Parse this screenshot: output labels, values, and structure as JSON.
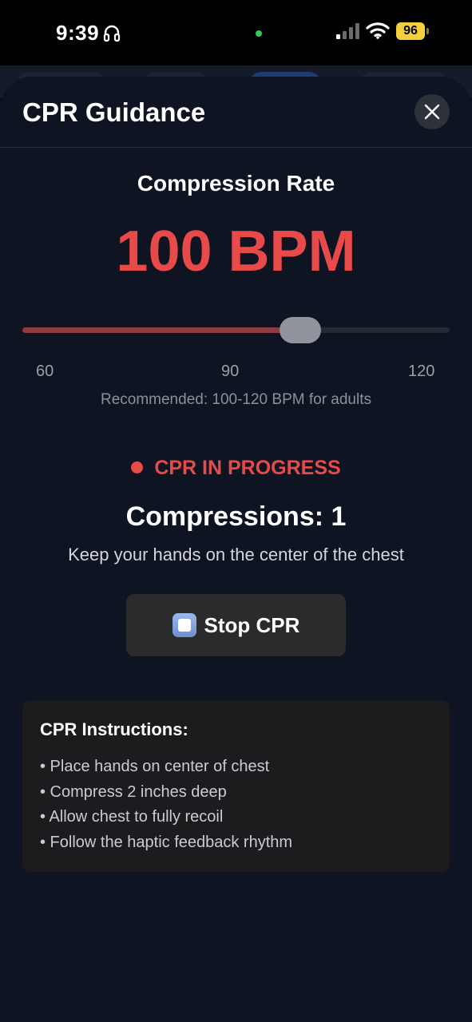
{
  "status_bar": {
    "time": "9:39",
    "battery": "96",
    "icons": [
      "headphones-icon",
      "signal-icon",
      "wifi-icon",
      "battery-icon"
    ]
  },
  "sheet": {
    "title": "CPR Guidance",
    "close_icon": "close-icon"
  },
  "rate": {
    "heading": "Compression Rate",
    "value_label": "100 BPM",
    "slider": {
      "min": 60,
      "max": 120,
      "value": 100,
      "ticks": [
        "60",
        "90",
        "120"
      ]
    },
    "recommendation": "Recommended: 100-120 BPM for adults"
  },
  "session": {
    "status": "CPR IN PROGRESS",
    "compressions_label": "Compressions: 1",
    "hint": "Keep your hands on the center of the chest",
    "stop_button_label": "Stop CPR",
    "stop_icon": "stop-icon"
  },
  "instructions": {
    "title": "CPR Instructions:",
    "items": [
      "• Place hands on center of chest",
      "• Compress 2 inches deep",
      "• Allow chest to fully recoil",
      "• Follow the haptic feedback rhythm"
    ]
  },
  "colors": {
    "accent_red": "#e84a4a",
    "sheet_background": "#0e1422",
    "card_background": "#1c1c1e",
    "battery_yellow": "#f4d03f"
  }
}
